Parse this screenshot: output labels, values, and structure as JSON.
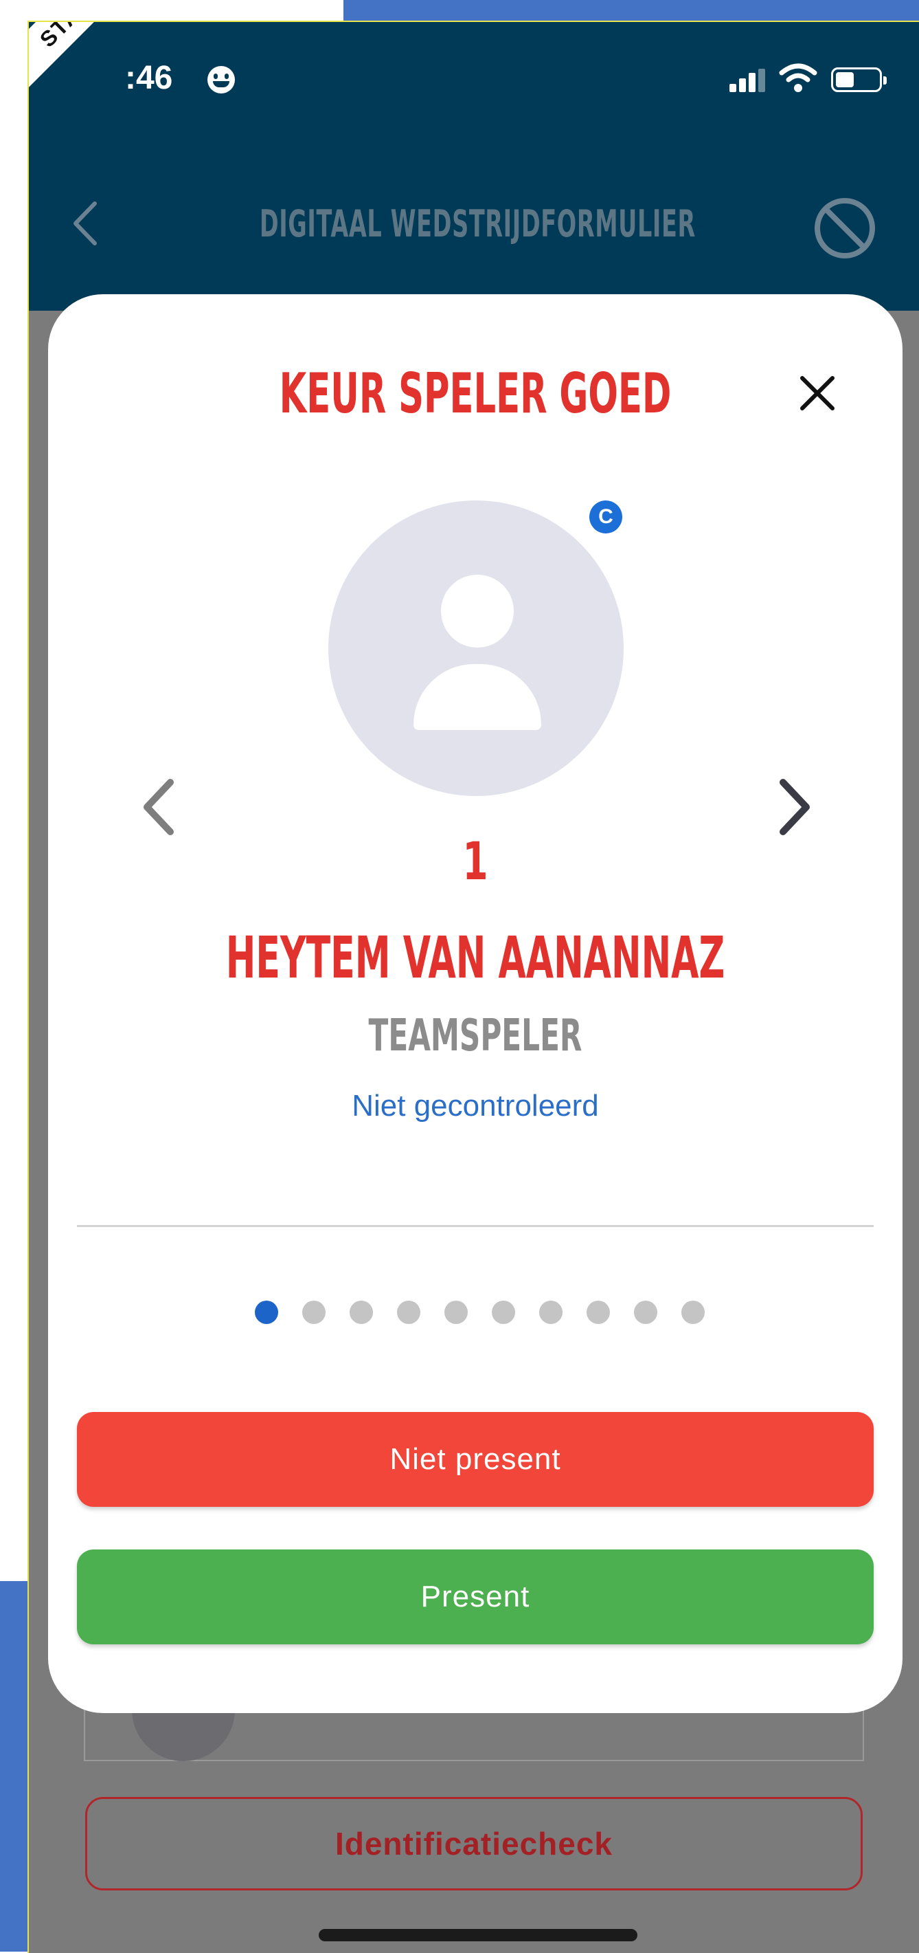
{
  "status_bar": {
    "time": ":46",
    "staging_ribbon": "STAGING",
    "icons": [
      "smiley-icon",
      "signal-icon",
      "wifi-icon",
      "battery-icon"
    ]
  },
  "navbar": {
    "title": "DIGITAAL WEDSTRIJDFORMULIER",
    "back_icon": "chevron-left-icon",
    "action_icon": "ban-icon"
  },
  "background": {
    "identification_button": "Identificatiecheck"
  },
  "modal": {
    "title": "KEUR SPELER GOED",
    "close_icon": "close-icon",
    "captain_badge": "C",
    "player": {
      "number": "1",
      "name": "HEYTEM VAN AANANNAZ",
      "role": "TEAMSPELER",
      "status": "Niet gecontroleerd"
    },
    "pagination": {
      "total": 10,
      "active_index": 0
    },
    "buttons": {
      "absent": "Niet present",
      "present": "Present"
    }
  },
  "colors": {
    "navbar": "#003a56",
    "accent_red": "#e2322d",
    "button_red": "#f2463b",
    "button_green": "#4caf50",
    "link_blue": "#2b6ec7"
  }
}
